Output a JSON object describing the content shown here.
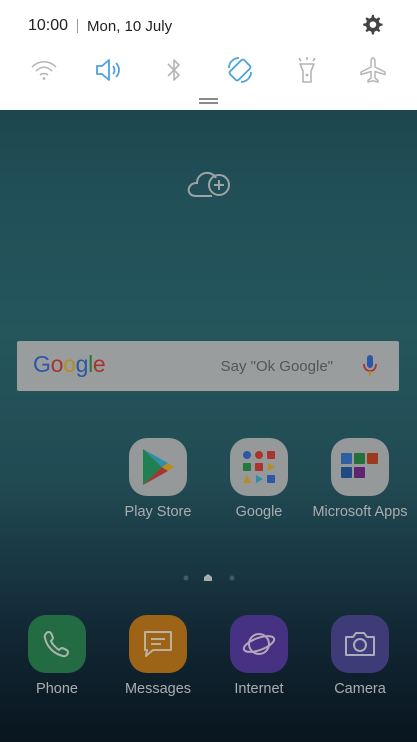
{
  "status": {
    "time": "10:00",
    "date": "Mon, 10 July"
  },
  "quick_settings": {
    "toggles": [
      {
        "name": "wifi",
        "icon": "wifi-icon",
        "active": false
      },
      {
        "name": "sound",
        "icon": "sound-icon",
        "active": true
      },
      {
        "name": "bluetooth",
        "icon": "bluetooth-icon",
        "active": false
      },
      {
        "name": "auto-rotate",
        "icon": "rotate-icon",
        "active": true
      },
      {
        "name": "flashlight",
        "icon": "flashlight-icon",
        "active": false
      },
      {
        "name": "airplane",
        "icon": "airplane-icon",
        "active": false
      }
    ],
    "active_color": "#4aa3df",
    "inactive_color": "#b5b5b5"
  },
  "search": {
    "logo": "Google",
    "placeholder": "Say \"Ok Google\""
  },
  "apps": [
    {
      "label": "Play Store"
    },
    {
      "label": "Google"
    },
    {
      "label": "Microsoft Apps"
    }
  ],
  "dock": [
    {
      "label": "Phone"
    },
    {
      "label": "Messages"
    },
    {
      "label": "Internet"
    },
    {
      "label": "Camera"
    }
  ]
}
